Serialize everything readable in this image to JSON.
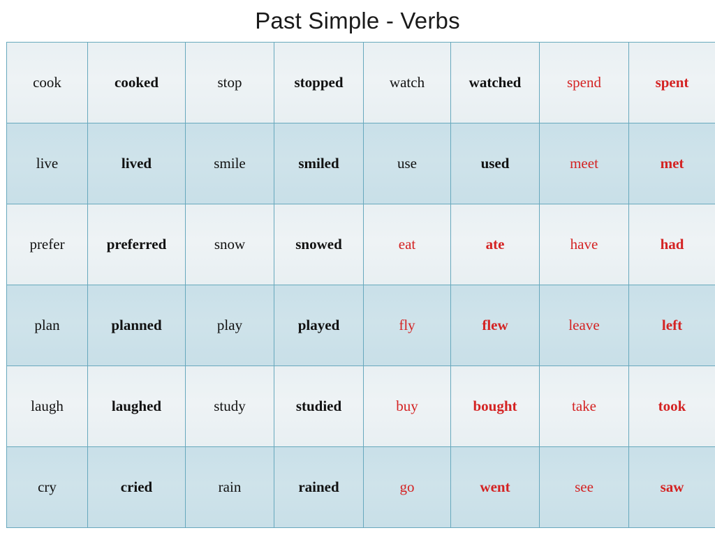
{
  "page": {
    "title": "Past Simple - Verbs"
  },
  "colors": {
    "regular_verb_text": "#111111",
    "irregular_verb_text": "#d42323",
    "cell_border": "#67a8bd",
    "row_light_background": "#eaf1f4",
    "row_dark_background": "#cbe1e9",
    "page_background": "#ffffff",
    "title_text": "#1a1a1a"
  },
  "table": {
    "columns": 8,
    "rows": 6,
    "pairs_per_row": 4,
    "column_pattern": [
      "base",
      "past",
      "base",
      "past",
      "base",
      "past",
      "base",
      "past"
    ],
    "rows_data": [
      {
        "shade": "light",
        "cells": [
          {
            "text": "cook",
            "form": "base",
            "type": "regular",
            "bold": false,
            "color": "#111111"
          },
          {
            "text": "cooked",
            "form": "past",
            "type": "regular",
            "bold": true,
            "color": "#111111"
          },
          {
            "text": "stop",
            "form": "base",
            "type": "regular",
            "bold": false,
            "color": "#111111"
          },
          {
            "text": "stopped",
            "form": "past",
            "type": "regular",
            "bold": true,
            "color": "#111111"
          },
          {
            "text": "watch",
            "form": "base",
            "type": "regular",
            "bold": false,
            "color": "#111111"
          },
          {
            "text": "watched",
            "form": "past",
            "type": "regular",
            "bold": true,
            "color": "#111111"
          },
          {
            "text": "spend",
            "form": "base",
            "type": "irregular",
            "bold": false,
            "color": "#d42323"
          },
          {
            "text": "spent",
            "form": "past",
            "type": "irregular",
            "bold": true,
            "color": "#d42323"
          }
        ]
      },
      {
        "shade": "dark",
        "cells": [
          {
            "text": "live",
            "form": "base",
            "type": "regular",
            "bold": false,
            "color": "#111111"
          },
          {
            "text": "lived",
            "form": "past",
            "type": "regular",
            "bold": true,
            "color": "#111111"
          },
          {
            "text": "smile",
            "form": "base",
            "type": "regular",
            "bold": false,
            "color": "#111111"
          },
          {
            "text": "smiled",
            "form": "past",
            "type": "regular",
            "bold": true,
            "color": "#111111"
          },
          {
            "text": "use",
            "form": "base",
            "type": "regular",
            "bold": false,
            "color": "#111111"
          },
          {
            "text": "used",
            "form": "past",
            "type": "regular",
            "bold": true,
            "color": "#111111"
          },
          {
            "text": "meet",
            "form": "base",
            "type": "irregular",
            "bold": false,
            "color": "#d42323"
          },
          {
            "text": "met",
            "form": "past",
            "type": "irregular",
            "bold": true,
            "color": "#d42323"
          }
        ]
      },
      {
        "shade": "light",
        "cells": [
          {
            "text": "prefer",
            "form": "base",
            "type": "regular",
            "bold": false,
            "color": "#111111"
          },
          {
            "text": "preferred",
            "form": "past",
            "type": "regular",
            "bold": true,
            "color": "#111111"
          },
          {
            "text": "snow",
            "form": "base",
            "type": "regular",
            "bold": false,
            "color": "#111111"
          },
          {
            "text": "snowed",
            "form": "past",
            "type": "regular",
            "bold": true,
            "color": "#111111"
          },
          {
            "text": "eat",
            "form": "base",
            "type": "irregular",
            "bold": false,
            "color": "#d42323"
          },
          {
            "text": "ate",
            "form": "past",
            "type": "irregular",
            "bold": true,
            "color": "#d42323"
          },
          {
            "text": "have",
            "form": "base",
            "type": "irregular",
            "bold": false,
            "color": "#d42323"
          },
          {
            "text": "had",
            "form": "past",
            "type": "irregular",
            "bold": true,
            "color": "#d42323"
          }
        ]
      },
      {
        "shade": "dark",
        "cells": [
          {
            "text": "plan",
            "form": "base",
            "type": "regular",
            "bold": false,
            "color": "#111111"
          },
          {
            "text": "planned",
            "form": "past",
            "type": "regular",
            "bold": true,
            "color": "#111111"
          },
          {
            "text": "play",
            "form": "base",
            "type": "regular",
            "bold": false,
            "color": "#111111"
          },
          {
            "text": "played",
            "form": "past",
            "type": "regular",
            "bold": true,
            "color": "#111111"
          },
          {
            "text": "fly",
            "form": "base",
            "type": "irregular",
            "bold": false,
            "color": "#d42323"
          },
          {
            "text": "flew",
            "form": "past",
            "type": "irregular",
            "bold": true,
            "color": "#d42323"
          },
          {
            "text": "leave",
            "form": "base",
            "type": "irregular",
            "bold": false,
            "color": "#d42323"
          },
          {
            "text": "left",
            "form": "past",
            "type": "irregular",
            "bold": true,
            "color": "#d42323"
          }
        ]
      },
      {
        "shade": "light",
        "cells": [
          {
            "text": "laugh",
            "form": "base",
            "type": "regular",
            "bold": false,
            "color": "#111111"
          },
          {
            "text": "laughed",
            "form": "past",
            "type": "regular",
            "bold": true,
            "color": "#111111"
          },
          {
            "text": "study",
            "form": "base",
            "type": "regular",
            "bold": false,
            "color": "#111111"
          },
          {
            "text": "studied",
            "form": "past",
            "type": "regular",
            "bold": true,
            "color": "#111111"
          },
          {
            "text": "buy",
            "form": "base",
            "type": "irregular",
            "bold": false,
            "color": "#d42323"
          },
          {
            "text": "bought",
            "form": "past",
            "type": "irregular",
            "bold": true,
            "color": "#d42323"
          },
          {
            "text": "take",
            "form": "base",
            "type": "irregular",
            "bold": false,
            "color": "#d42323"
          },
          {
            "text": "took",
            "form": "past",
            "type": "irregular",
            "bold": true,
            "color": "#d42323"
          }
        ]
      },
      {
        "shade": "dark",
        "cells": [
          {
            "text": "cry",
            "form": "base",
            "type": "regular",
            "bold": false,
            "color": "#111111"
          },
          {
            "text": "cried",
            "form": "past",
            "type": "regular",
            "bold": true,
            "color": "#111111"
          },
          {
            "text": "rain",
            "form": "base",
            "type": "regular",
            "bold": false,
            "color": "#111111"
          },
          {
            "text": "rained",
            "form": "past",
            "type": "regular",
            "bold": true,
            "color": "#111111"
          },
          {
            "text": "go",
            "form": "base",
            "type": "irregular",
            "bold": false,
            "color": "#d42323"
          },
          {
            "text": "went",
            "form": "past",
            "type": "irregular",
            "bold": true,
            "color": "#d42323"
          },
          {
            "text": "see",
            "form": "base",
            "type": "irregular",
            "bold": false,
            "color": "#d42323"
          },
          {
            "text": "saw",
            "form": "past",
            "type": "irregular",
            "bold": true,
            "color": "#d42323"
          }
        ]
      }
    ]
  }
}
